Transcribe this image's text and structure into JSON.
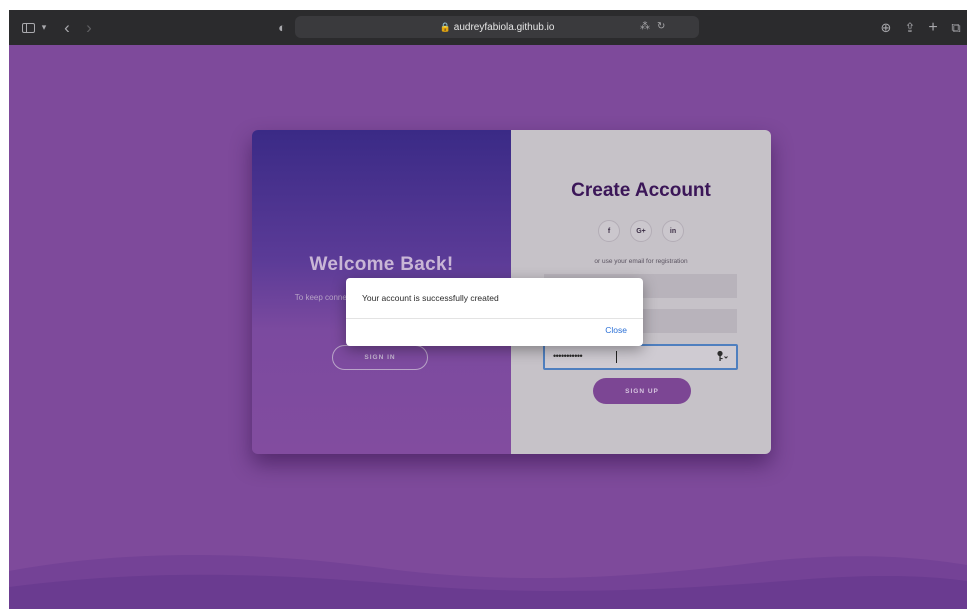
{
  "browser": {
    "url": "audreyfabiola.github.io",
    "sidebar_icon": "sidebar-icon",
    "chevron": "▾",
    "back": "‹",
    "forward": "›",
    "shield": "◐",
    "translate_icon": "⁂",
    "reload": "↻",
    "download": "⊕",
    "share": "⇪",
    "new_tab": "+",
    "tabs": "⧉"
  },
  "left_panel": {
    "title": "Welcome Back!",
    "subtitle": "To keep connected with us please login with your Motherhood info",
    "signin_label": "SIGN IN"
  },
  "right_panel": {
    "title": "Create Account",
    "socials": [
      "f",
      "G+",
      "in"
    ],
    "or_text": "or use your email for registration",
    "name_value": "",
    "email_value": "",
    "password_masked": "•••••••••••",
    "password_key_icon": "key-icon",
    "signup_label": "SIGN UP"
  },
  "dialog": {
    "message": "Your account is successfully created",
    "close_label": "Close"
  },
  "colors": {
    "page_bg": "#7e4a9b",
    "accent_purple": "#7c4694",
    "title_dark": "#3b1658",
    "link_blue": "#2a6fd6"
  }
}
